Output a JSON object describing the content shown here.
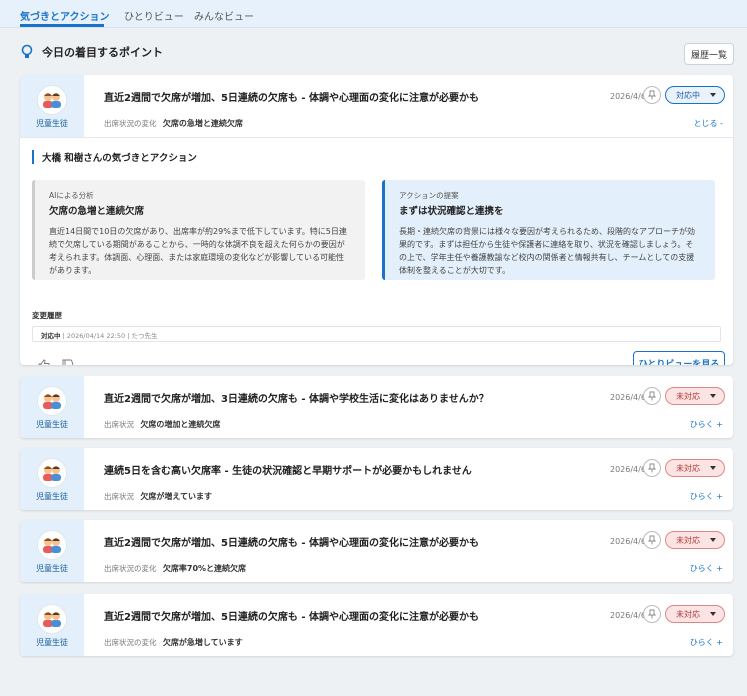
{
  "tabs": [
    {
      "label": "気づきとアクション"
    },
    {
      "label": "ひとりビュー"
    },
    {
      "label": "みんなビュー"
    }
  ],
  "header": {
    "title": "今日の着目するポイント",
    "history_button": "履歴一覧",
    "icon": "lightbulb-icon"
  },
  "cards": [
    {
      "student_label": "児童生徒",
      "title": "直近2週間で欠席が増加、5日連続の欠席も - 体調や心理面の変化に注意が必要かも",
      "meta_label": "出席状況の変化",
      "meta_value": "欠席の急増と連続欠席",
      "date": "2026/4/6",
      "status": "対応中",
      "toggle": "とじる -",
      "expanded": {
        "title": "大橋 和樹さんの気づきとアクション",
        "ai_label": "AIによる分析",
        "ai_head": "欠席の急増と連続欠席",
        "ai_body": "直近14日間で10日の欠席があり、出席率が約29%まで低下しています。特に5日連続で欠席している期間があることから、一時的な体調不良を超えた何らかの要因が考えられます。体調面、心理面、または家庭環境の変化などが影響している可能性があります。",
        "action_label": "アクションの提案",
        "action_head": "まずは状況確認と連携を",
        "action_body": "長期・連続欠席の背景には様々な要因が考えられるため、段階的なアプローチが効果的です。まずは担任から生徒や保護者に連絡を取り、状況を確認しましょう。その上で、学年主任や養護教諭など校内の関係者と情報共有し、チームとしての支援体制を整えることが大切です。",
        "log_label": "変更履歴",
        "log_status": "対応中",
        "log_timestamp": "2026/04/14 22:50",
        "log_user": "たつ先生",
        "view_button": "ひとりビューを見る"
      }
    },
    {
      "student_label": "児童生徒",
      "title": "直近2週間で欠席が増加、3日連続の欠席も - 体調や学校生活に変化はありませんか？",
      "meta_label": "出席状況",
      "meta_value": "欠席の増加と連続欠席",
      "date": "2026/4/6",
      "status": "未対応",
      "toggle": "ひらく +"
    },
    {
      "student_label": "児童生徒",
      "title": "連続5日を含む高い欠席率 - 生徒の状況確認と早期サポートが必要かもしれません",
      "meta_label": "出席状況",
      "meta_value": "欠席が増えています",
      "date": "2026/4/6",
      "status": "未対応",
      "toggle": "ひらく +"
    },
    {
      "student_label": "児童生徒",
      "title": "直近2週間で欠席が増加、5日連続の欠席も - 体調や心理面の変化に注意が必要かも",
      "meta_label": "出席状況の変化",
      "meta_value": "欠席率70%と連続欠席",
      "date": "2026/4/6",
      "status": "未対応",
      "toggle": "ひらく +"
    },
    {
      "student_label": "児童生徒",
      "title": "直近2週間で欠席が増加、5日連続の欠席も - 体調や心理面の変化に注意が必要かも",
      "meta_label": "出席状況の変化",
      "meta_value": "欠席が急増しています",
      "date": "2026/4/6",
      "status": "未対応",
      "toggle": "ひらく +"
    }
  ],
  "colors": {
    "accent": "#1a73c8",
    "tab_bar": "#e6f1fb",
    "status_active_bg": "#eaf3fc",
    "status_pending_bg": "#fde4e4",
    "status_pending_border": "#e08686"
  }
}
